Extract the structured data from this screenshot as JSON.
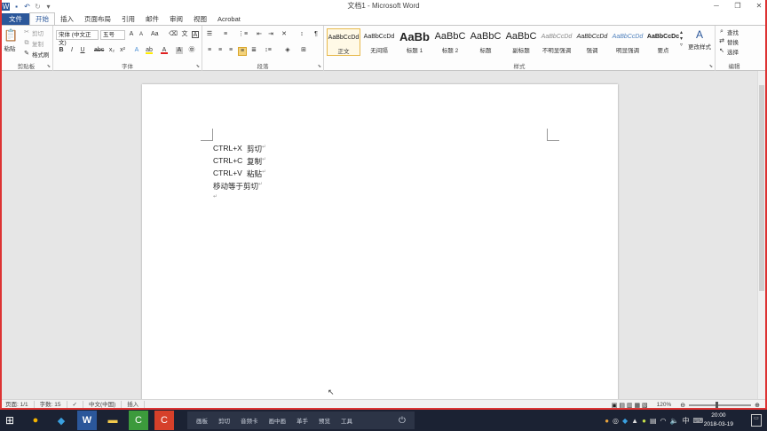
{
  "window": {
    "title": "文档1 - Microsoft Word"
  },
  "tabs": [
    {
      "label": "文件"
    },
    {
      "label": "开始"
    },
    {
      "label": "插入"
    },
    {
      "label": "页面布局"
    },
    {
      "label": "引用"
    },
    {
      "label": "邮件"
    },
    {
      "label": "审阅"
    },
    {
      "label": "视图"
    },
    {
      "label": "Acrobat"
    }
  ],
  "ribbon": {
    "clipboard": {
      "label": "剪贴板",
      "paste": "粘贴",
      "cut": "剪切",
      "copy": "复制",
      "format_painter": "格式刷"
    },
    "font": {
      "label": "字体",
      "font_name": "宋体 (中文正文)",
      "font_size": "五号"
    },
    "paragraph": {
      "label": "段落"
    },
    "styles": {
      "label": "样式",
      "items": [
        {
          "sample": "AaBbCcDd",
          "name": "正文"
        },
        {
          "sample": "AaBbCcDd",
          "name": "无间隔"
        },
        {
          "sample": "AaBb",
          "name": "标题 1"
        },
        {
          "sample": "AaBbC",
          "name": "标题 2"
        },
        {
          "sample": "AaBbC",
          "name": "标题"
        },
        {
          "sample": "AaBbC",
          "name": "副标题"
        },
        {
          "sample": "AaBbCcDd",
          "name": "不明显强调"
        },
        {
          "sample": "AaBbCcDd",
          "name": "强调"
        },
        {
          "sample": "AaBbCcDd",
          "name": "明显强调"
        },
        {
          "sample": "AaBbCcDc",
          "name": "要点"
        }
      ],
      "change_styles": "更改样式"
    },
    "editing": {
      "label": "编辑",
      "find": "查找",
      "replace": "替换",
      "select": "选择"
    }
  },
  "document": {
    "lines": [
      {
        "key": "CTRL+X",
        "text": "剪切"
      },
      {
        "key": "CTRL+C",
        "text": "复制"
      },
      {
        "key": "CTRL+V",
        "text": "粘贴"
      },
      {
        "key": "",
        "text": "移动等于剪切"
      }
    ]
  },
  "status": {
    "page": "页面: 1/1",
    "words": "字数: 15",
    "language": "中文(中国)",
    "mode": "插入",
    "zoom": "120%"
  },
  "taskbar": {
    "items": [
      "画板",
      "剪切",
      "音频卡",
      "画中画",
      "革手",
      "预览",
      "工具"
    ],
    "time": "20:00",
    "date": "2018-03-19",
    "ime": "中"
  },
  "colors": {
    "accent": "#2b579a",
    "frame": "#dd3333",
    "taskbar": "#1b2233"
  }
}
